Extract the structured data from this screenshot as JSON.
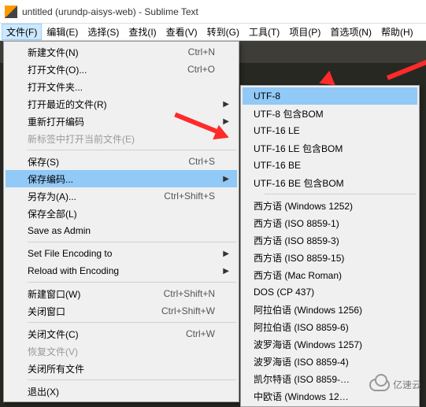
{
  "window": {
    "title": "untitled (urundp-aisys-web) - Sublime Text"
  },
  "menubar": [
    {
      "label": "文件(F)",
      "active": true
    },
    {
      "label": "编辑(E)"
    },
    {
      "label": "选择(S)"
    },
    {
      "label": "查找(I)"
    },
    {
      "label": "查看(V)"
    },
    {
      "label": "转到(G)"
    },
    {
      "label": "工具(T)"
    },
    {
      "label": "项目(P)"
    },
    {
      "label": "首选项(N)"
    },
    {
      "label": "帮助(H)"
    }
  ],
  "file_menu": [
    {
      "label": "新建文件(N)",
      "shortcut": "Ctrl+N"
    },
    {
      "label": "打开文件(O)...",
      "shortcut": "Ctrl+O"
    },
    {
      "label": "打开文件夹..."
    },
    {
      "label": "打开最近的文件(R)",
      "submenu": true
    },
    {
      "label": "重新打开编码",
      "submenu": true
    },
    {
      "label": "新标签中打开当前文件(E)",
      "disabled": true
    },
    {
      "sep": true
    },
    {
      "label": "保存(S)",
      "shortcut": "Ctrl+S"
    },
    {
      "label": "保存编码...",
      "submenu": true,
      "hover": true
    },
    {
      "label": "另存为(A)...",
      "shortcut": "Ctrl+Shift+S"
    },
    {
      "label": "保存全部(L)"
    },
    {
      "label": "Save as Admin"
    },
    {
      "sep": true
    },
    {
      "label": "Set File Encoding to",
      "submenu": true
    },
    {
      "label": "Reload with Encoding",
      "submenu": true
    },
    {
      "sep": true
    },
    {
      "label": "新建窗口(W)",
      "shortcut": "Ctrl+Shift+N"
    },
    {
      "label": "关闭窗口",
      "shortcut": "Ctrl+Shift+W"
    },
    {
      "sep": true
    },
    {
      "label": "关闭文件(C)",
      "shortcut": "Ctrl+W"
    },
    {
      "label": "恢复文件(V)",
      "disabled": true
    },
    {
      "label": "关闭所有文件"
    },
    {
      "sep": true
    },
    {
      "label": "退出(X)"
    }
  ],
  "encoding_menu": [
    {
      "label": "UTF-8",
      "hover": true
    },
    {
      "label": "UTF-8 包含BOM"
    },
    {
      "label": "UTF-16 LE"
    },
    {
      "label": "UTF-16 LE 包含BOM"
    },
    {
      "label": "UTF-16 BE"
    },
    {
      "label": "UTF-16 BE 包含BOM"
    },
    {
      "sep": true
    },
    {
      "label": "西方语 (Windows 1252)"
    },
    {
      "label": "西方语 (ISO 8859-1)"
    },
    {
      "label": "西方语 (ISO 8859-3)"
    },
    {
      "label": "西方语 (ISO 8859-15)"
    },
    {
      "label": "西方语 (Mac Roman)"
    },
    {
      "label": "DOS (CP 437)"
    },
    {
      "label": "阿拉伯语 (Windows 1256)"
    },
    {
      "label": "阿拉伯语 (ISO 8859-6)"
    },
    {
      "label": "波罗海语 (Windows 1257)"
    },
    {
      "label": "波罗海语 (ISO 8859-4)"
    },
    {
      "label": "凯尔特语 (ISO 8859-…"
    },
    {
      "label": "中欧语 (Windows 12…"
    }
  ],
  "watermark": "亿速云"
}
